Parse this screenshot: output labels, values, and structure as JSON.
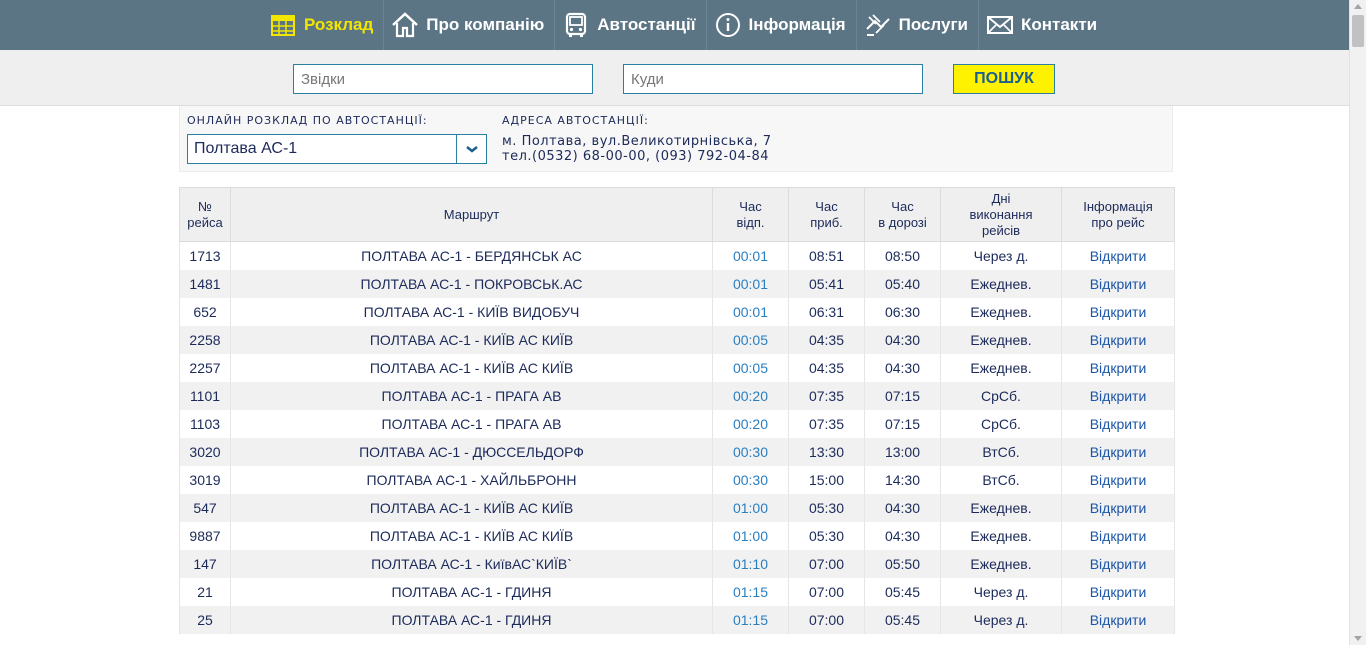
{
  "nav": [
    {
      "label": "Розклад",
      "icon": "schedule-icon",
      "active": true
    },
    {
      "label": "Про компанію",
      "icon": "home-icon",
      "active": false
    },
    {
      "label": "Автостанції",
      "icon": "bus-icon",
      "active": false
    },
    {
      "label": "Інформація",
      "icon": "info-icon",
      "active": false
    },
    {
      "label": "Послуги",
      "icon": "services-icon",
      "active": false
    },
    {
      "label": "Контакти",
      "icon": "mail-icon",
      "active": false
    }
  ],
  "search": {
    "from_placeholder": "Звідки",
    "to_placeholder": "Куди",
    "button_label": "ПОШУК"
  },
  "station": {
    "schedule_label": "ОНЛАЙН РОЗКЛАД ПО АВТОСТАНЦІЇ:",
    "selected": "Полтава АС-1",
    "address_label": "АДРЕСА АВТОСТАНЦІЇ:",
    "address_line1": "м. Полтава, вул.Великотирнівська, 7",
    "address_line2": "тел.(0532) 68-00-00, (093) 792-04-84"
  },
  "table": {
    "headers": [
      "№\nрейса",
      "Маршрут",
      "Час\nвідп.",
      "Час\nприб.",
      "Час\nв дорозі",
      "Дні\nвиконання\nрейсів",
      "Інформація\nпро рейс"
    ],
    "rows": [
      {
        "num": "1713",
        "route": "ПОЛТАВА АС-1  -  БЕРДЯНСЬК АС",
        "dep": "00:01",
        "arr": "08:51",
        "dur": "08:50",
        "days": "Через д.",
        "info": "Відкрити"
      },
      {
        "num": "1481",
        "route": "ПОЛТАВА АС-1  -  ПОКРОВСЬК.АС",
        "dep": "00:01",
        "arr": "05:41",
        "dur": "05:40",
        "days": "Ежеднев.",
        "info": "Відкрити"
      },
      {
        "num": "652",
        "route": "ПОЛТАВА АС-1  -  КИЇВ ВИДОБУЧ",
        "dep": "00:01",
        "arr": "06:31",
        "dur": "06:30",
        "days": "Ежеднев.",
        "info": "Відкрити"
      },
      {
        "num": "2258",
        "route": "ПОЛТАВА АС-1  -  КИЇВ АС КИЇВ",
        "dep": "00:05",
        "arr": "04:35",
        "dur": "04:30",
        "days": "Ежеднев.",
        "info": "Відкрити"
      },
      {
        "num": "2257",
        "route": "ПОЛТАВА АС-1  -  КИЇВ АС КИЇВ",
        "dep": "00:05",
        "arr": "04:35",
        "dur": "04:30",
        "days": "Ежеднев.",
        "info": "Відкрити"
      },
      {
        "num": "1101",
        "route": "ПОЛТАВА АС-1  -  ПРАГА АВ",
        "dep": "00:20",
        "arr": "07:35",
        "dur": "07:15",
        "days": "СрСб.",
        "info": "Відкрити"
      },
      {
        "num": "1103",
        "route": "ПОЛТАВА АС-1  -  ПРАГА АВ",
        "dep": "00:20",
        "arr": "07:35",
        "dur": "07:15",
        "days": "СрСб.",
        "info": "Відкрити"
      },
      {
        "num": "3020",
        "route": "ПОЛТАВА АС-1  -  ДЮССЕЛЬДОРФ",
        "dep": "00:30",
        "arr": "13:30",
        "dur": "13:00",
        "days": "ВтСб.",
        "info": "Відкрити"
      },
      {
        "num": "3019",
        "route": "ПОЛТАВА АС-1  -  ХАЙЛЬБРОНН",
        "dep": "00:30",
        "arr": "15:00",
        "dur": "14:30",
        "days": "ВтСб.",
        "info": "Відкрити"
      },
      {
        "num": "547",
        "route": "ПОЛТАВА АС-1  -  КИЇВ АС КИЇВ",
        "dep": "01:00",
        "arr": "05:30",
        "dur": "04:30",
        "days": "Ежеднев.",
        "info": "Відкрити"
      },
      {
        "num": "9887",
        "route": "ПОЛТАВА АС-1  -  КИЇВ АС КИЇВ",
        "dep": "01:00",
        "arr": "05:30",
        "dur": "04:30",
        "days": "Ежеднев.",
        "info": "Відкрити"
      },
      {
        "num": "147",
        "route": "ПОЛТАВА АС-1  -  КиївАС`КИЇВ`",
        "dep": "01:10",
        "arr": "07:00",
        "dur": "05:50",
        "days": "Ежеднев.",
        "info": "Відкрити"
      },
      {
        "num": "21",
        "route": "ПОЛТАВА АС-1  -  ГДИНЯ",
        "dep": "01:15",
        "arr": "07:00",
        "dur": "05:45",
        "days": "Через д.",
        "info": "Відкрити"
      },
      {
        "num": "25",
        "route": "ПОЛТАВА АС-1  -  ГДИНЯ",
        "dep": "01:15",
        "arr": "07:00",
        "dur": "05:45",
        "days": "Через д.",
        "info": "Відкрити"
      }
    ]
  }
}
